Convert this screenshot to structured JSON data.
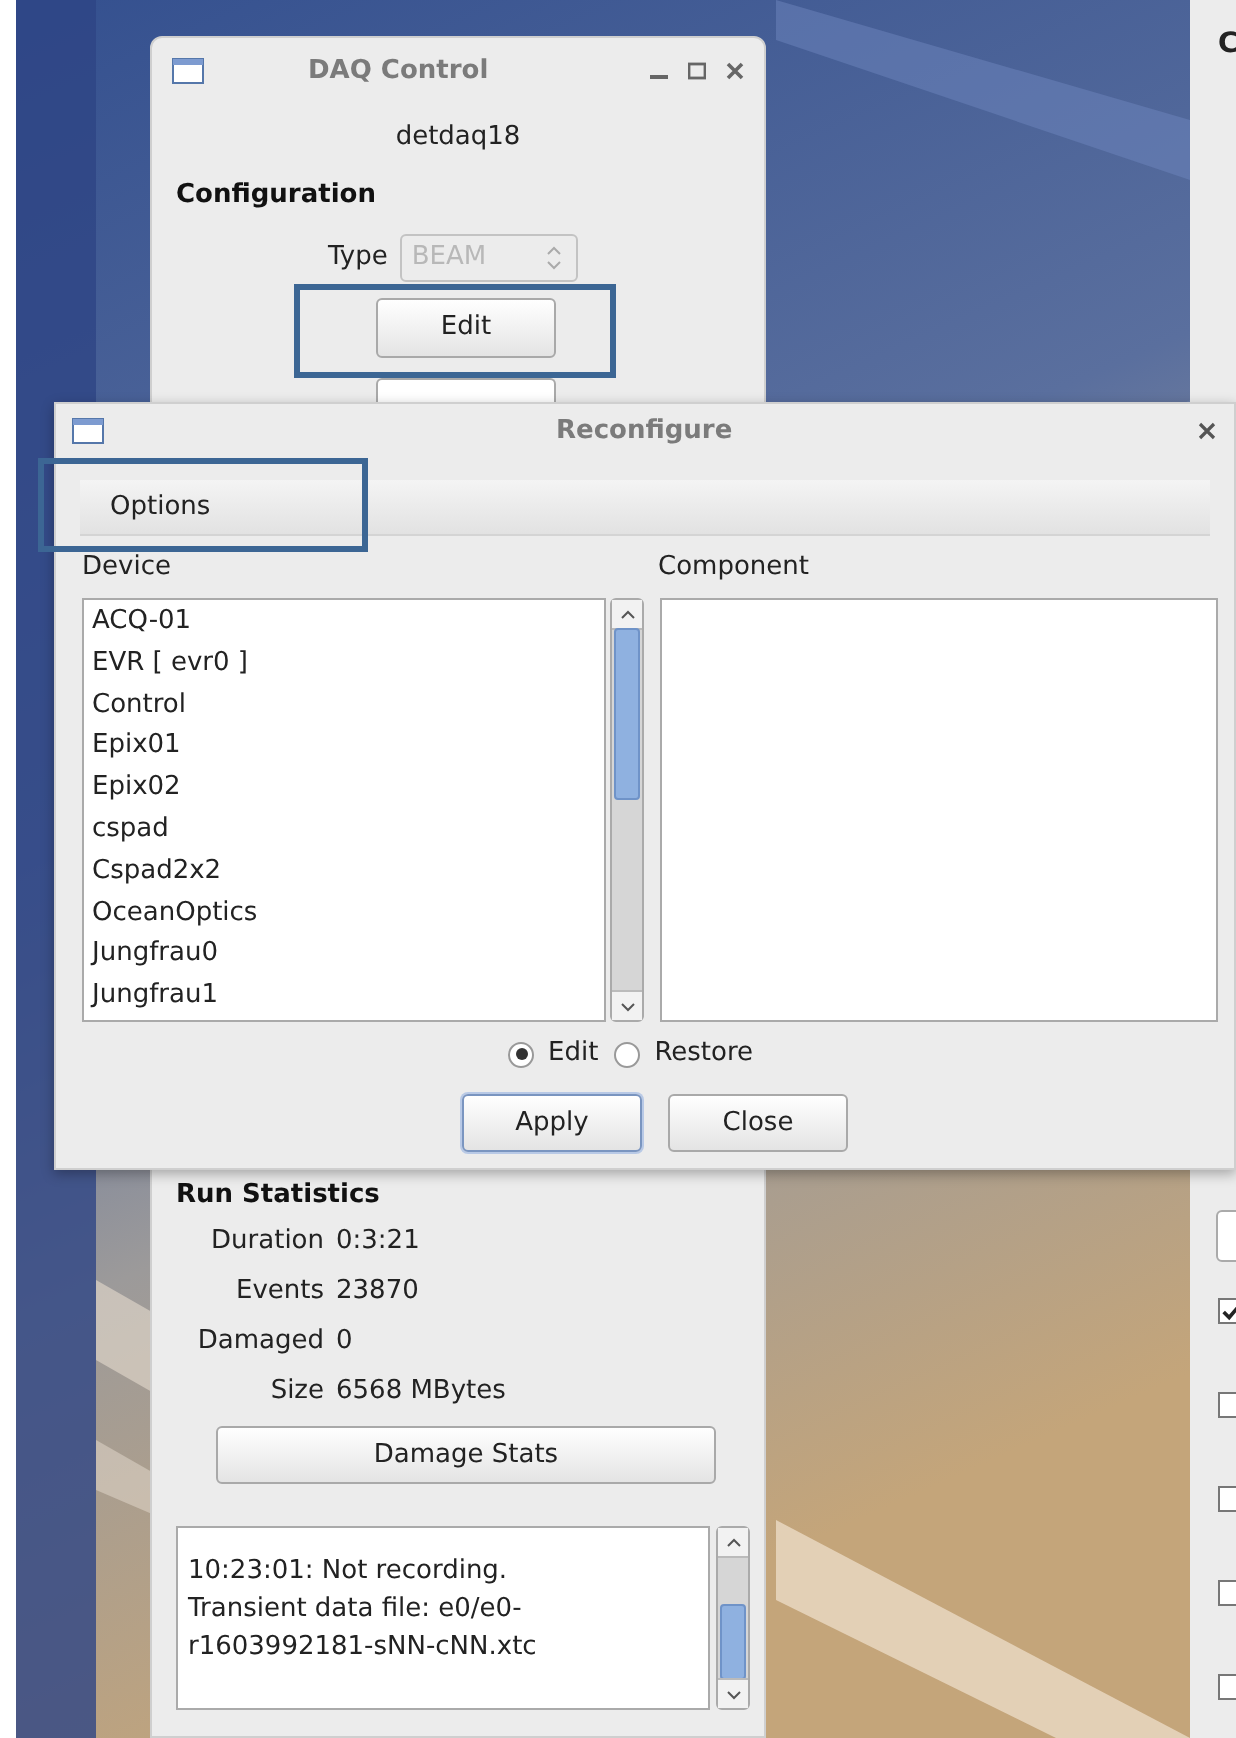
{
  "daq_window": {
    "title": "DAQ Control",
    "host": "detdaq18",
    "configuration_heading": "Configuration",
    "type_label": "Type",
    "type_value": "BEAM",
    "type_disabled": true,
    "edit_button": "Edit",
    "run_statistics_heading": "Run Statistics",
    "stats": [
      {
        "label": "Duration",
        "value": "0:3:21"
      },
      {
        "label": "Events",
        "value": "23870"
      },
      {
        "label": "Damaged",
        "value": "0"
      },
      {
        "label": "Size",
        "value": "6568 MBytes"
      }
    ],
    "damage_stats_button": "Damage Stats",
    "log_lines": [
      "10:23:01: Not recording.",
      "Transient data file: e0/e0-",
      "r1603992181-sNN-cNN.xtc"
    ]
  },
  "reconfigure_dialog": {
    "title": "Reconfigure",
    "menu": [
      {
        "label": "Options"
      }
    ],
    "device_heading": "Device",
    "component_heading": "Component",
    "devices": [
      "ACQ-01",
      "EVR [ evr0 ]",
      "Control",
      "Epix01",
      "Epix02",
      "cspad",
      "Cspad2x2",
      "OceanOptics",
      "Jungfrau0",
      "Jungfrau1"
    ],
    "modes": [
      {
        "label": "Edit",
        "selected": true
      },
      {
        "label": "Restore",
        "selected": false
      }
    ],
    "buttons": [
      {
        "label": "Apply",
        "default": true
      },
      {
        "label": "Close",
        "default": false
      }
    ]
  },
  "right_panel": {
    "title_fragment": "C",
    "checkboxes": [
      {
        "checked": true
      },
      {
        "checked": false
      },
      {
        "checked": false
      },
      {
        "checked": false
      },
      {
        "checked": false
      }
    ]
  }
}
